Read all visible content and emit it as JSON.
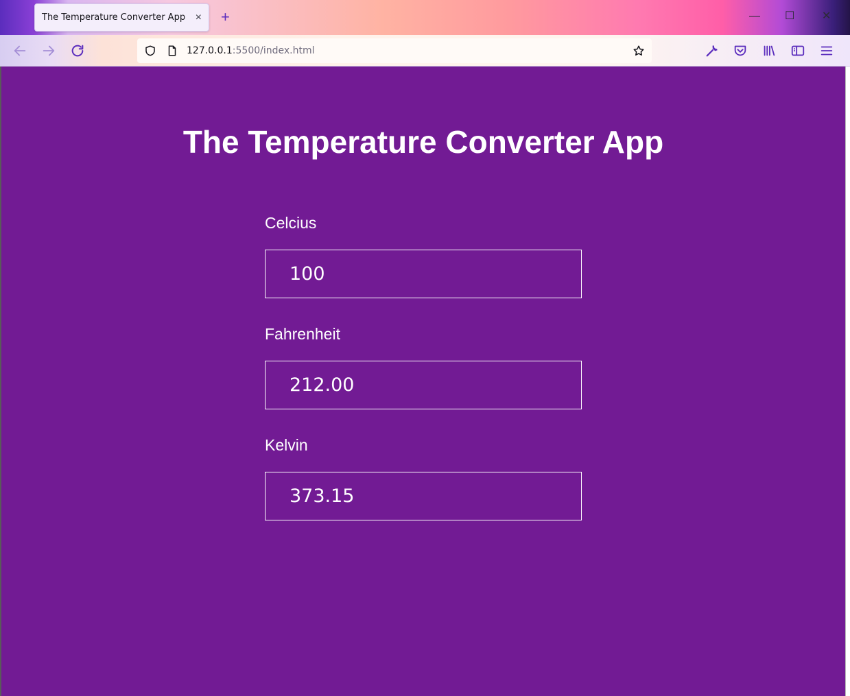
{
  "browser": {
    "tab_title": "The Temperature Converter App",
    "tab_close": "×",
    "new_tab": "+",
    "url_host": "127.0.0.1",
    "url_path": ":5500/index.html",
    "window_controls": {
      "minimize": "—",
      "maximize": "☐",
      "close": "✕"
    },
    "icons": [
      "back-arrow-icon",
      "forward-arrow-icon",
      "reload-icon",
      "shield-icon",
      "page-icon",
      "star-icon",
      "wrench-icon",
      "pocket-icon",
      "library-icon",
      "sidebar-icon",
      "menu-icon"
    ],
    "accent_color": "#5b2dbd"
  },
  "app": {
    "title": "The Temperature Converter App",
    "background_color": "#721b94",
    "fields": [
      {
        "label": "Celcius",
        "value": "100"
      },
      {
        "label": "Fahrenheit",
        "value": "212.00"
      },
      {
        "label": "Kelvin",
        "value": "373.15"
      }
    ]
  }
}
